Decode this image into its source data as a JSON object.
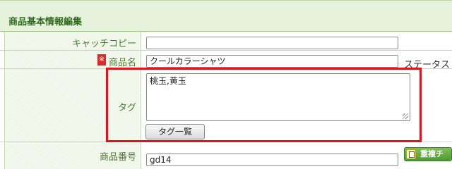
{
  "panel": {
    "title": "商品基本情報編集"
  },
  "fields": {
    "catch_copy": {
      "label": "キャッチコピー",
      "value": ""
    },
    "product_name": {
      "required_mark": "※",
      "label": "商品名",
      "value": "クールカラーシャツ"
    },
    "status": {
      "label": "ステータス"
    },
    "tags": {
      "label": "タグ",
      "value": "桃玉,黄玉",
      "list_button": "タグ一覧"
    },
    "product_number": {
      "label": "商品番号",
      "value": "gd14",
      "dup_button": "重複チ"
    }
  },
  "colors": {
    "highlight": "#e0141c",
    "header_bg": "#e6f2dc",
    "label_text": "#4a7a32",
    "required": "#d92b2b"
  }
}
